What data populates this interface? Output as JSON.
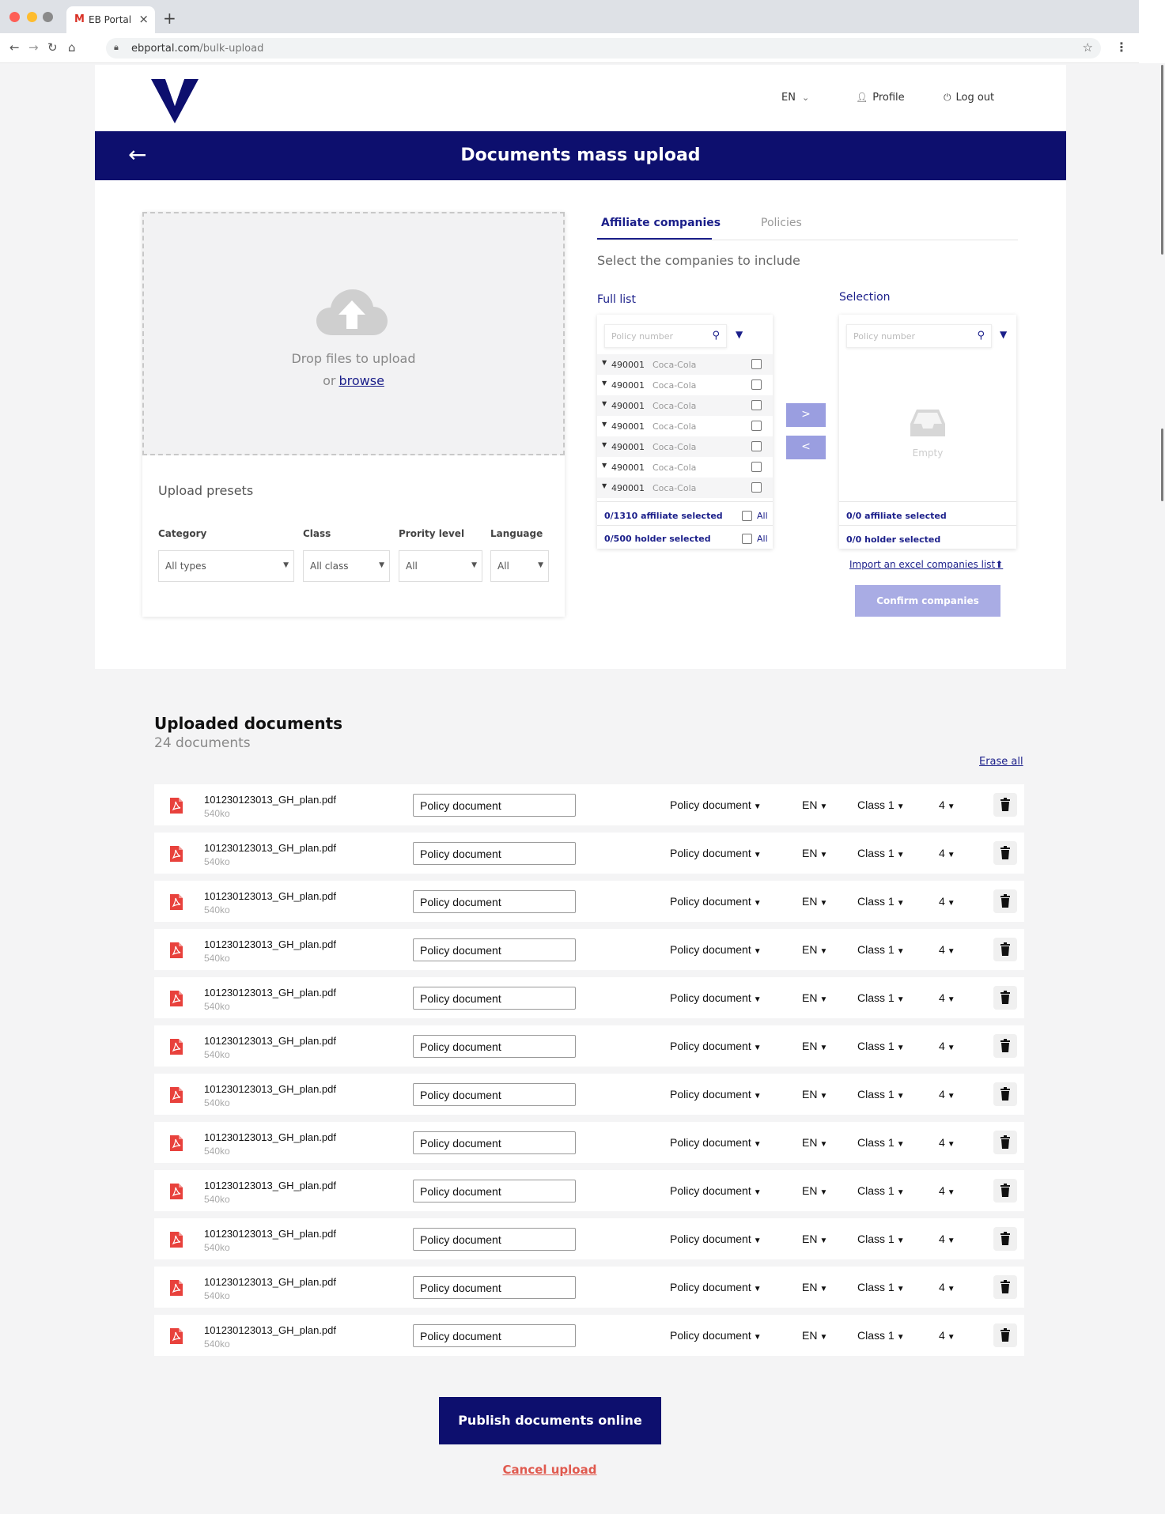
{
  "browser": {
    "tab_title": "EB Portal",
    "tab_favicon": "M",
    "url_host": "ebportal.com",
    "url_path": "/bulk-upload",
    "new_tab": "+",
    "close_glyph": "×"
  },
  "header": {
    "lang": "EN",
    "profile_label": "Profile",
    "logout_label": "Log out",
    "page_title": "Documents mass upload",
    "back_glyph": "←"
  },
  "upload": {
    "drop_text": "Drop files to upload",
    "or_text": "or",
    "browse_label": "browse",
    "presets_title": "Upload presets",
    "presets": [
      {
        "label": "Category",
        "value": "All types"
      },
      {
        "label": "Class",
        "value": "All class"
      },
      {
        "label": "Prority level",
        "value": "All"
      },
      {
        "label": "Language",
        "value": "All"
      }
    ]
  },
  "companies": {
    "tab_affiliate": "Affiliate companies",
    "tab_policies": "Policies",
    "hint": "Select the companies to include",
    "full_list_title": "Full list",
    "selection_title": "Selection",
    "search_placeholder": "Policy number",
    "rows": [
      {
        "number": "490001",
        "name": "Coca-Cola"
      },
      {
        "number": "490001",
        "name": "Coca-Cola"
      },
      {
        "number": "490001",
        "name": "Coca-Cola"
      },
      {
        "number": "490001",
        "name": "Coca-Cola"
      },
      {
        "number": "490001",
        "name": "Coca-Cola"
      },
      {
        "number": "490001",
        "name": "Coca-Cola"
      },
      {
        "number": "490001",
        "name": "Coca-Cola"
      }
    ],
    "affiliate_selected": "0/1310 affiliate selected",
    "holder_selected": "0/500 holder selected",
    "all_label": "All",
    "empty_label": "Empty",
    "sel_affiliate": "0/0 affiliate selected",
    "sel_holder": "0/0 holder selected",
    "move_right": ">",
    "move_left": "<",
    "import_link": "Import an excel companies list",
    "confirm_label": "Confirm companies"
  },
  "documents": {
    "title": "Uploaded documents",
    "count": "24 documents",
    "erase_all": "Erase all",
    "rows": [
      {
        "file": "101230123013_GH_plan.pdf",
        "size": "540ko",
        "name_value": "Policy document",
        "type": "Policy document",
        "lang": "EN",
        "class": "Class 1",
        "priority": "4"
      },
      {
        "file": "101230123013_GH_plan.pdf",
        "size": "540ko",
        "name_value": "Policy document",
        "type": "Policy document",
        "lang": "EN",
        "class": "Class 1",
        "priority": "4"
      },
      {
        "file": "101230123013_GH_plan.pdf",
        "size": "540ko",
        "name_value": "Policy document",
        "type": "Policy document",
        "lang": "EN",
        "class": "Class 1",
        "priority": "4"
      },
      {
        "file": "101230123013_GH_plan.pdf",
        "size": "540ko",
        "name_value": "Policy document",
        "type": "Policy document",
        "lang": "EN",
        "class": "Class 1",
        "priority": "4"
      },
      {
        "file": "101230123013_GH_plan.pdf",
        "size": "540ko",
        "name_value": "Policy document",
        "type": "Policy document",
        "lang": "EN",
        "class": "Class 1",
        "priority": "4"
      },
      {
        "file": "101230123013_GH_plan.pdf",
        "size": "540ko",
        "name_value": "Policy document",
        "type": "Policy document",
        "lang": "EN",
        "class": "Class 1",
        "priority": "4"
      },
      {
        "file": "101230123013_GH_plan.pdf",
        "size": "540ko",
        "name_value": "Policy document",
        "type": "Policy document",
        "lang": "EN",
        "class": "Class 1",
        "priority": "4"
      },
      {
        "file": "101230123013_GH_plan.pdf",
        "size": "540ko",
        "name_value": "Policy document",
        "type": "Policy document",
        "lang": "EN",
        "class": "Class 1",
        "priority": "4"
      },
      {
        "file": "101230123013_GH_plan.pdf",
        "size": "540ko",
        "name_value": "Policy document",
        "type": "Policy document",
        "lang": "EN",
        "class": "Class 1",
        "priority": "4"
      },
      {
        "file": "101230123013_GH_plan.pdf",
        "size": "540ko",
        "name_value": "Policy document",
        "type": "Policy document",
        "lang": "EN",
        "class": "Class 1",
        "priority": "4"
      },
      {
        "file": "101230123013_GH_plan.pdf",
        "size": "540ko",
        "name_value": "Policy document",
        "type": "Policy document",
        "lang": "EN",
        "class": "Class 1",
        "priority": "4"
      },
      {
        "file": "101230123013_GH_plan.pdf",
        "size": "540ko",
        "name_value": "Policy document",
        "type": "Policy document",
        "lang": "EN",
        "class": "Class 1",
        "priority": "4"
      }
    ],
    "publish_label": "Publish documents online",
    "cancel_label": "Cancel upload"
  },
  "colors": {
    "brand_navy": "#0d0f6e",
    "link_blue": "#1b1f8a",
    "disabled_btn": "#a9ace4",
    "pdf_red": "#e8413c",
    "cancel_red": "#e05a4f"
  }
}
